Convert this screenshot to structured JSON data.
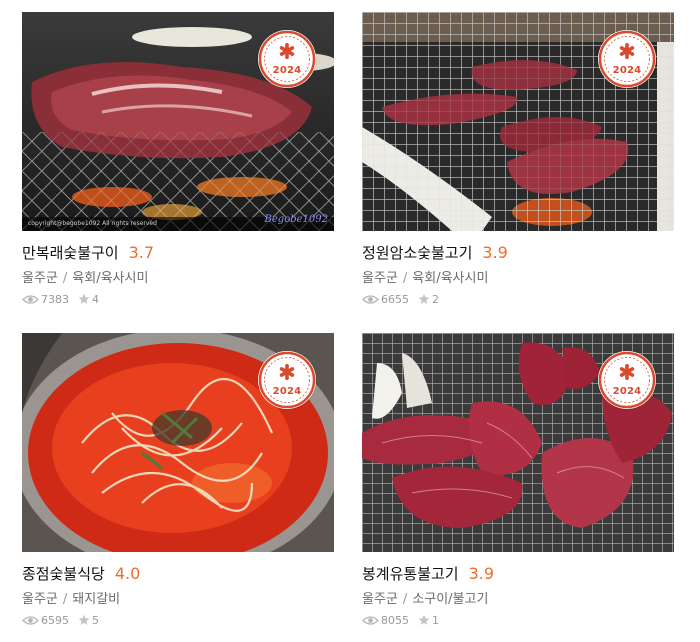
{
  "restaurants": [
    {
      "name": "만복래숯불구이",
      "rating": "3.7",
      "region": "울주군",
      "category": "육회/육사시미",
      "views": "7383",
      "reviews": "4",
      "badge_year": "2024",
      "photo_watermark": "copyright@begobe1092 All rights reserved",
      "photo_signature": "Begobe1092"
    },
    {
      "name": "정원암소숯불고기",
      "rating": "3.9",
      "region": "울주군",
      "category": "육회/육사시미",
      "views": "6655",
      "reviews": "2",
      "badge_year": "2024"
    },
    {
      "name": "종점숯불식당",
      "rating": "4.0",
      "region": "울주군",
      "category": "돼지갈비",
      "views": "6595",
      "reviews": "5",
      "badge_year": "2024"
    },
    {
      "name": "봉계유통불고기",
      "rating": "3.9",
      "region": "울주군",
      "category": "소구이/불고기",
      "views": "8055",
      "reviews": "1",
      "badge_year": "2024"
    }
  ],
  "separator": "/",
  "colors": {
    "rating": "#ef6c2c",
    "badge": "#d94a2e",
    "meta": "#6b6b6b",
    "stats": "#999999"
  },
  "icons": {
    "views": "eye-icon",
    "reviews": "star-icon",
    "badge": "asterisk-emblem-icon"
  }
}
